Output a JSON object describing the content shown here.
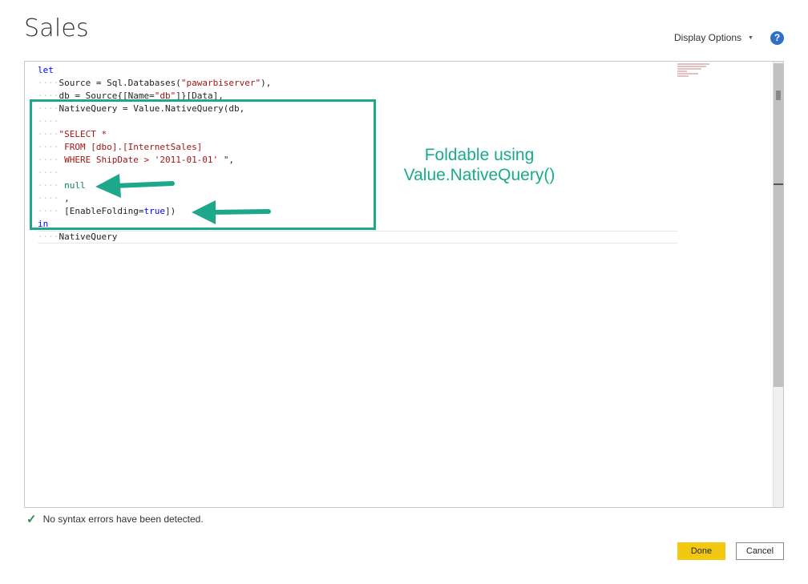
{
  "header": {
    "title": "Sales",
    "display_options_label": "Display Options",
    "help_symbol": "?"
  },
  "editor": {
    "lines": [
      {
        "indent": 0,
        "parts": [
          {
            "t": "let",
            "c": "kw"
          }
        ]
      },
      {
        "indent": 1,
        "parts": [
          {
            "t": "Source = Sql.Databases(",
            "c": ""
          },
          {
            "t": "\"pawarbiserver\"",
            "c": "str"
          },
          {
            "t": "),",
            "c": ""
          }
        ]
      },
      {
        "indent": 1,
        "parts": [
          {
            "t": "db = Source{[Name=",
            "c": ""
          },
          {
            "t": "\"db\"",
            "c": "str"
          },
          {
            "t": "]}[Data],",
            "c": ""
          }
        ]
      },
      {
        "indent": 1,
        "parts": [
          {
            "t": "NativeQuery = Value.NativeQuery(db,",
            "c": ""
          }
        ]
      },
      {
        "indent": 1,
        "parts": []
      },
      {
        "indent": 1,
        "parts": [
          {
            "t": "\"SELECT *",
            "c": "strg"
          }
        ]
      },
      {
        "indent": 1,
        "parts": [
          {
            "t": " FROM [dbo].[InternetSales]",
            "c": "strg"
          }
        ]
      },
      {
        "indent": 1,
        "parts": [
          {
            "t": " WHERE ShipDate > '2011-01-01' ",
            "c": "strg"
          },
          {
            "t": "\",",
            "c": ""
          }
        ]
      },
      {
        "indent": 1,
        "parts": []
      },
      {
        "indent": 1,
        "parts": [
          {
            "t": " null",
            "c": "lit"
          }
        ]
      },
      {
        "indent": 1,
        "parts": [
          {
            "t": " ,",
            "c": ""
          }
        ]
      },
      {
        "indent": 1,
        "parts": [
          {
            "t": " [EnableFolding=",
            "c": ""
          },
          {
            "t": "true",
            "c": "kw"
          },
          {
            "t": "])",
            "c": ""
          }
        ]
      },
      {
        "indent": 0,
        "parts": [
          {
            "t": "in",
            "c": "kw"
          }
        ]
      },
      {
        "indent": 1,
        "parts": [
          {
            "t": "NativeQuery",
            "c": ""
          }
        ]
      }
    ]
  },
  "annotation": {
    "line1": "Foldable using",
    "line2": "Value.NativeQuery()",
    "color": "#1ea88b"
  },
  "status": {
    "message": "No syntax errors have been detected."
  },
  "buttons": {
    "done_label": "Done",
    "cancel_label": "Cancel",
    "done_color": "#f2c811"
  }
}
